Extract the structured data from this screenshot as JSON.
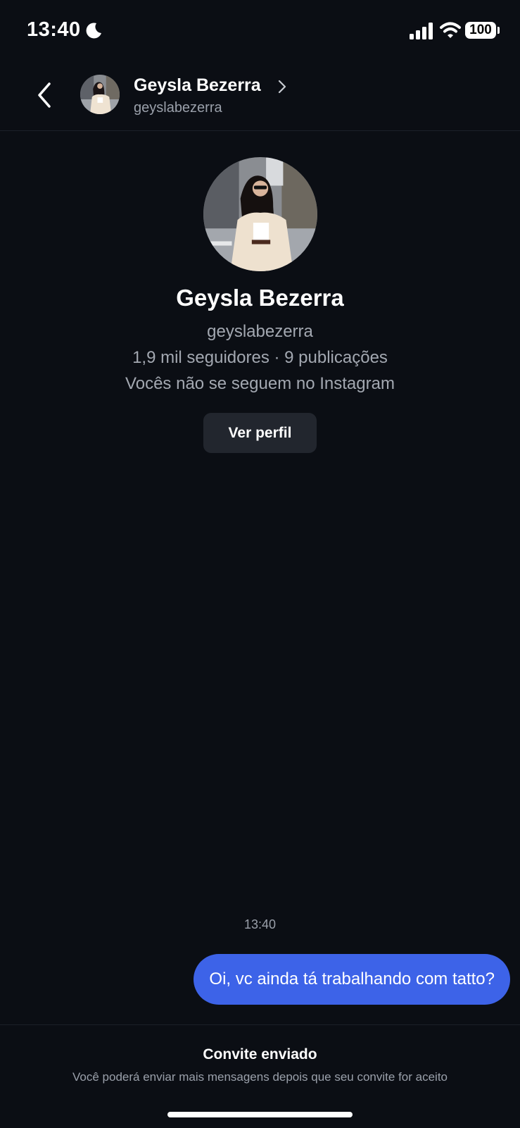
{
  "status_bar": {
    "time": "13:40",
    "battery": "100",
    "icons": [
      "moon-icon",
      "signal-icon",
      "wifi-icon",
      "battery-icon"
    ]
  },
  "header": {
    "name": "Geysla Bezerra",
    "username": "geyslabezerra",
    "icons": [
      "back-icon",
      "chevron-right-icon"
    ]
  },
  "profile": {
    "name": "Geysla Bezerra",
    "username": "geyslabezerra",
    "stats": "1,9 mil seguidores · 9 publicações",
    "relation": "Vocês não se seguem no Instagram",
    "view_profile_label": "Ver perfil"
  },
  "messages": {
    "time": "13:40",
    "items": [
      {
        "text": "Oi, vc ainda tá trabalhando com tatto?",
        "sender": "me"
      }
    ]
  },
  "footer": {
    "title": "Convite enviado",
    "subtitle": "Você poderá enviar mais mensagens depois que seu convite for aceito"
  },
  "colors": {
    "background": "#0b0e14",
    "bubble": "#3d63e8",
    "button": "#22262e",
    "secondary_text": "#a3a8b1"
  }
}
